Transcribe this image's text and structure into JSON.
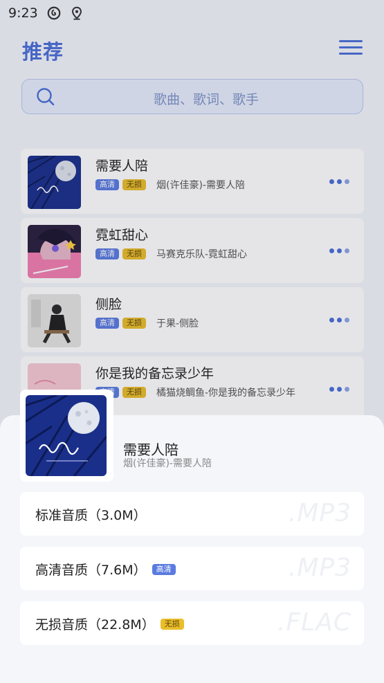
{
  "status_bar": {
    "time": "9:23"
  },
  "header": {
    "title": "推荐"
  },
  "search": {
    "placeholder": "歌曲、歌词、歌手"
  },
  "songs": [
    {
      "title": "需要人陪",
      "tag_hd": "高清",
      "tag_lossless": "无损",
      "artist": "烟(许佳豪)-需要人陪",
      "cover_icon": "moon-night-cover"
    },
    {
      "title": "霓虹甜心",
      "tag_hd": "高清",
      "tag_lossless": "无损",
      "artist": "马赛克乐队-霓虹甜心",
      "cover_icon": "anime-girl-pink-cover"
    },
    {
      "title": "侧脸",
      "tag_hd": "高清",
      "tag_lossless": "无损",
      "artist": "于果-侧脸",
      "cover_icon": "sitting-woman-cover"
    },
    {
      "title": "你是我的备忘录少年",
      "tag_hd": "高清",
      "tag_lossless": "无损",
      "artist": "橘猫烧鲷鱼-你是我的备忘录少年",
      "cover_icon": "pink-cover"
    }
  ],
  "sheet": {
    "song_title": "需要人陪",
    "song_artist": "烟(许佳豪)-需要人陪",
    "options": [
      {
        "label": "标准音质（3.0M）",
        "tag": "",
        "format": ".MP3"
      },
      {
        "label": "高清音质（7.6M）",
        "tag": "高清",
        "format": ".MP3"
      },
      {
        "label": "无损音质（22.8M）",
        "tag": "无损",
        "format": ".FLAC"
      }
    ]
  },
  "colors": {
    "accent": "#4a6fd8",
    "tag_hd": "#5a7be0",
    "tag_lossless": "#eabd2a"
  }
}
